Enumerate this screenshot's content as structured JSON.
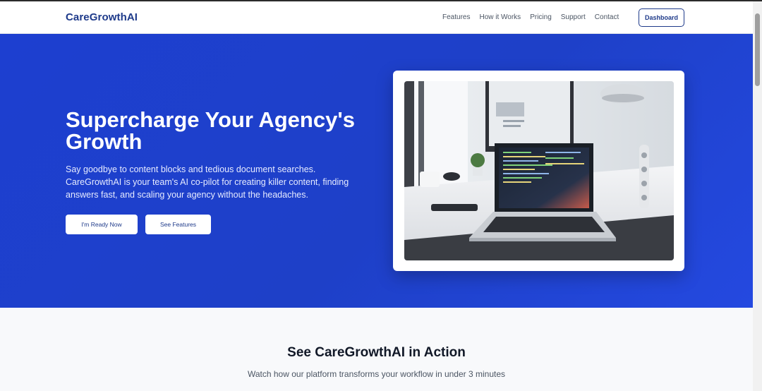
{
  "brand": {
    "name": "CareGrowthAI"
  },
  "nav": {
    "links": [
      "Features",
      "How it Works",
      "Pricing",
      "Support",
      "Contact"
    ],
    "dashboard_label": "Dashboard"
  },
  "hero": {
    "title": "Supercharge Your Agency's Growth",
    "description": "Say goodbye to content blocks and tedious document searches. CareGrowthAI is your team's AI co-pilot for creating killer content, finding answers fast, and scaling your agency without the headaches.",
    "primary_button": "I'm Ready Now",
    "secondary_button": "See Features",
    "image_alt": "Laptop with code on desk next to monitor and lamp"
  },
  "demo_section": {
    "title": "See CareGrowthAI in Action",
    "subtitle": "Watch how our platform transforms your workflow in under 3 minutes"
  },
  "colors": {
    "brand": "#1e3a8a",
    "hero_bg": "#1e40c8",
    "section_bg": "#f8f9fb"
  }
}
